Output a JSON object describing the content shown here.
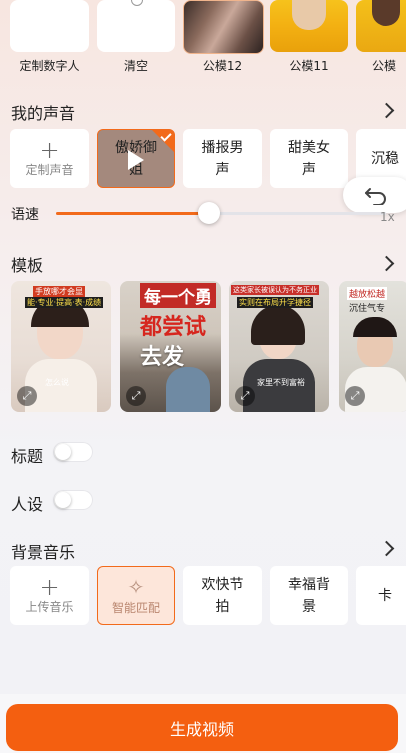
{
  "avatars": {
    "items": [
      {
        "label": "定制数字人"
      },
      {
        "label": "清空"
      },
      {
        "label": "公模12"
      },
      {
        "label": "公模11"
      },
      {
        "label": "公模"
      }
    ]
  },
  "voice": {
    "title": "我的声音",
    "add_label": "定制声音",
    "items": [
      {
        "label": "傲娇御姐",
        "selected": true
      },
      {
        "label": "播报男声"
      },
      {
        "label": "甜美女声"
      },
      {
        "label": "沉稳"
      }
    ]
  },
  "speed": {
    "label": "语速",
    "value_text": "1x",
    "level": 0.46
  },
  "template": {
    "title": "模板",
    "items": [
      {
        "caption_top": "手放哪才会显",
        "caption_top2": "能·专业·提高·表·成绩",
        "caption_bottom": "怎么说"
      },
      {
        "caption_top": "每一个勇",
        "caption_top2": "都尝试",
        "caption_bottom": "去发"
      },
      {
        "caption_top": "这类家长被误认为不务正业",
        "caption_top2": "实则在布局升学捷径",
        "caption_bottom": "家里不到富裕"
      },
      {
        "caption_top": "越放松越",
        "caption_top2": "沉住气专",
        "caption_bottom": ""
      }
    ]
  },
  "toggles": {
    "title_label": "标题",
    "persona_label": "人设"
  },
  "music": {
    "title": "背景音乐",
    "upload_label": "上传音乐",
    "smart_label": "智能匹配",
    "items": [
      {
        "label": "欢快节拍"
      },
      {
        "label": "幸福背景"
      },
      {
        "label": "卡"
      }
    ]
  },
  "generate": {
    "label": "生成视频"
  },
  "colors": {
    "accent": "#f45f10",
    "selected_bg": "#fde6da"
  }
}
